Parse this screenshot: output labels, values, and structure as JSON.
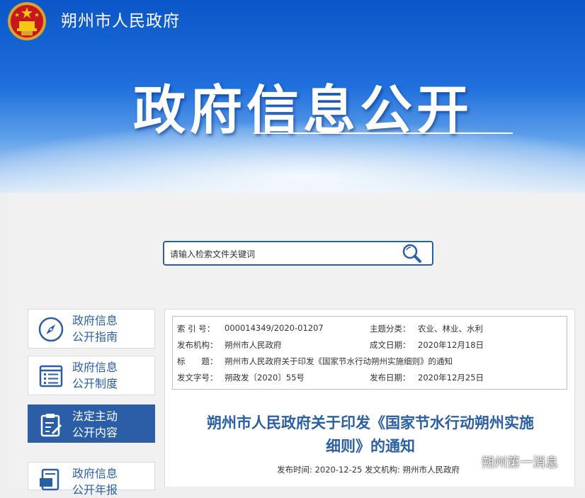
{
  "header": {
    "site_name": "朔州市人民政府",
    "banner_title": "政府信息公开"
  },
  "search": {
    "placeholder": "请输入检索文件关键词"
  },
  "nav": {
    "items": [
      {
        "line1": "政府信息",
        "line2": "公开指南",
        "icon": "compass-icon"
      },
      {
        "line1": "政府信息",
        "line2": "公开制度",
        "icon": "list-document-icon"
      },
      {
        "line1": "法定主动",
        "line2": "公开内容",
        "icon": "clipboard-edit-icon",
        "active": true
      },
      {
        "line1": "政府信息",
        "line2": "公开年报",
        "icon": "report-icon"
      }
    ]
  },
  "meta": {
    "index_label": "索 引 号：",
    "index_value": "000014349/2020-01207",
    "topic_label": "主题分类：",
    "topic_value": "农业、林业、水利",
    "issuer_label": "发布机构：",
    "issuer_value": "朔州市人民政府",
    "created_label": "成文日期：",
    "created_value": "2020年12月18日",
    "title_label": "标　　题：",
    "title_value": "朔州市人民政府关于印发《国家节水行动朔州实施细则》的通知",
    "docno_label": "发文字号：",
    "docno_value": "朔政发〔2020〕55号",
    "pubdate_label": "发布日期：",
    "pubdate_value": "2020年12月25日"
  },
  "document": {
    "title_line1": "朔州市人民政府关于印发《国家节水行动朔州实施",
    "title_line2": "细则》的通知",
    "pub_info": "发布时间: 2020-12-25 发文机构: 朔州市人民政府"
  },
  "watermark": {
    "text": "朔州第一消息"
  },
  "colors": {
    "header_blue": "#0b56c8",
    "nav_text": "#2b5fa3",
    "nav_active_bg": "#2b5ea6"
  }
}
